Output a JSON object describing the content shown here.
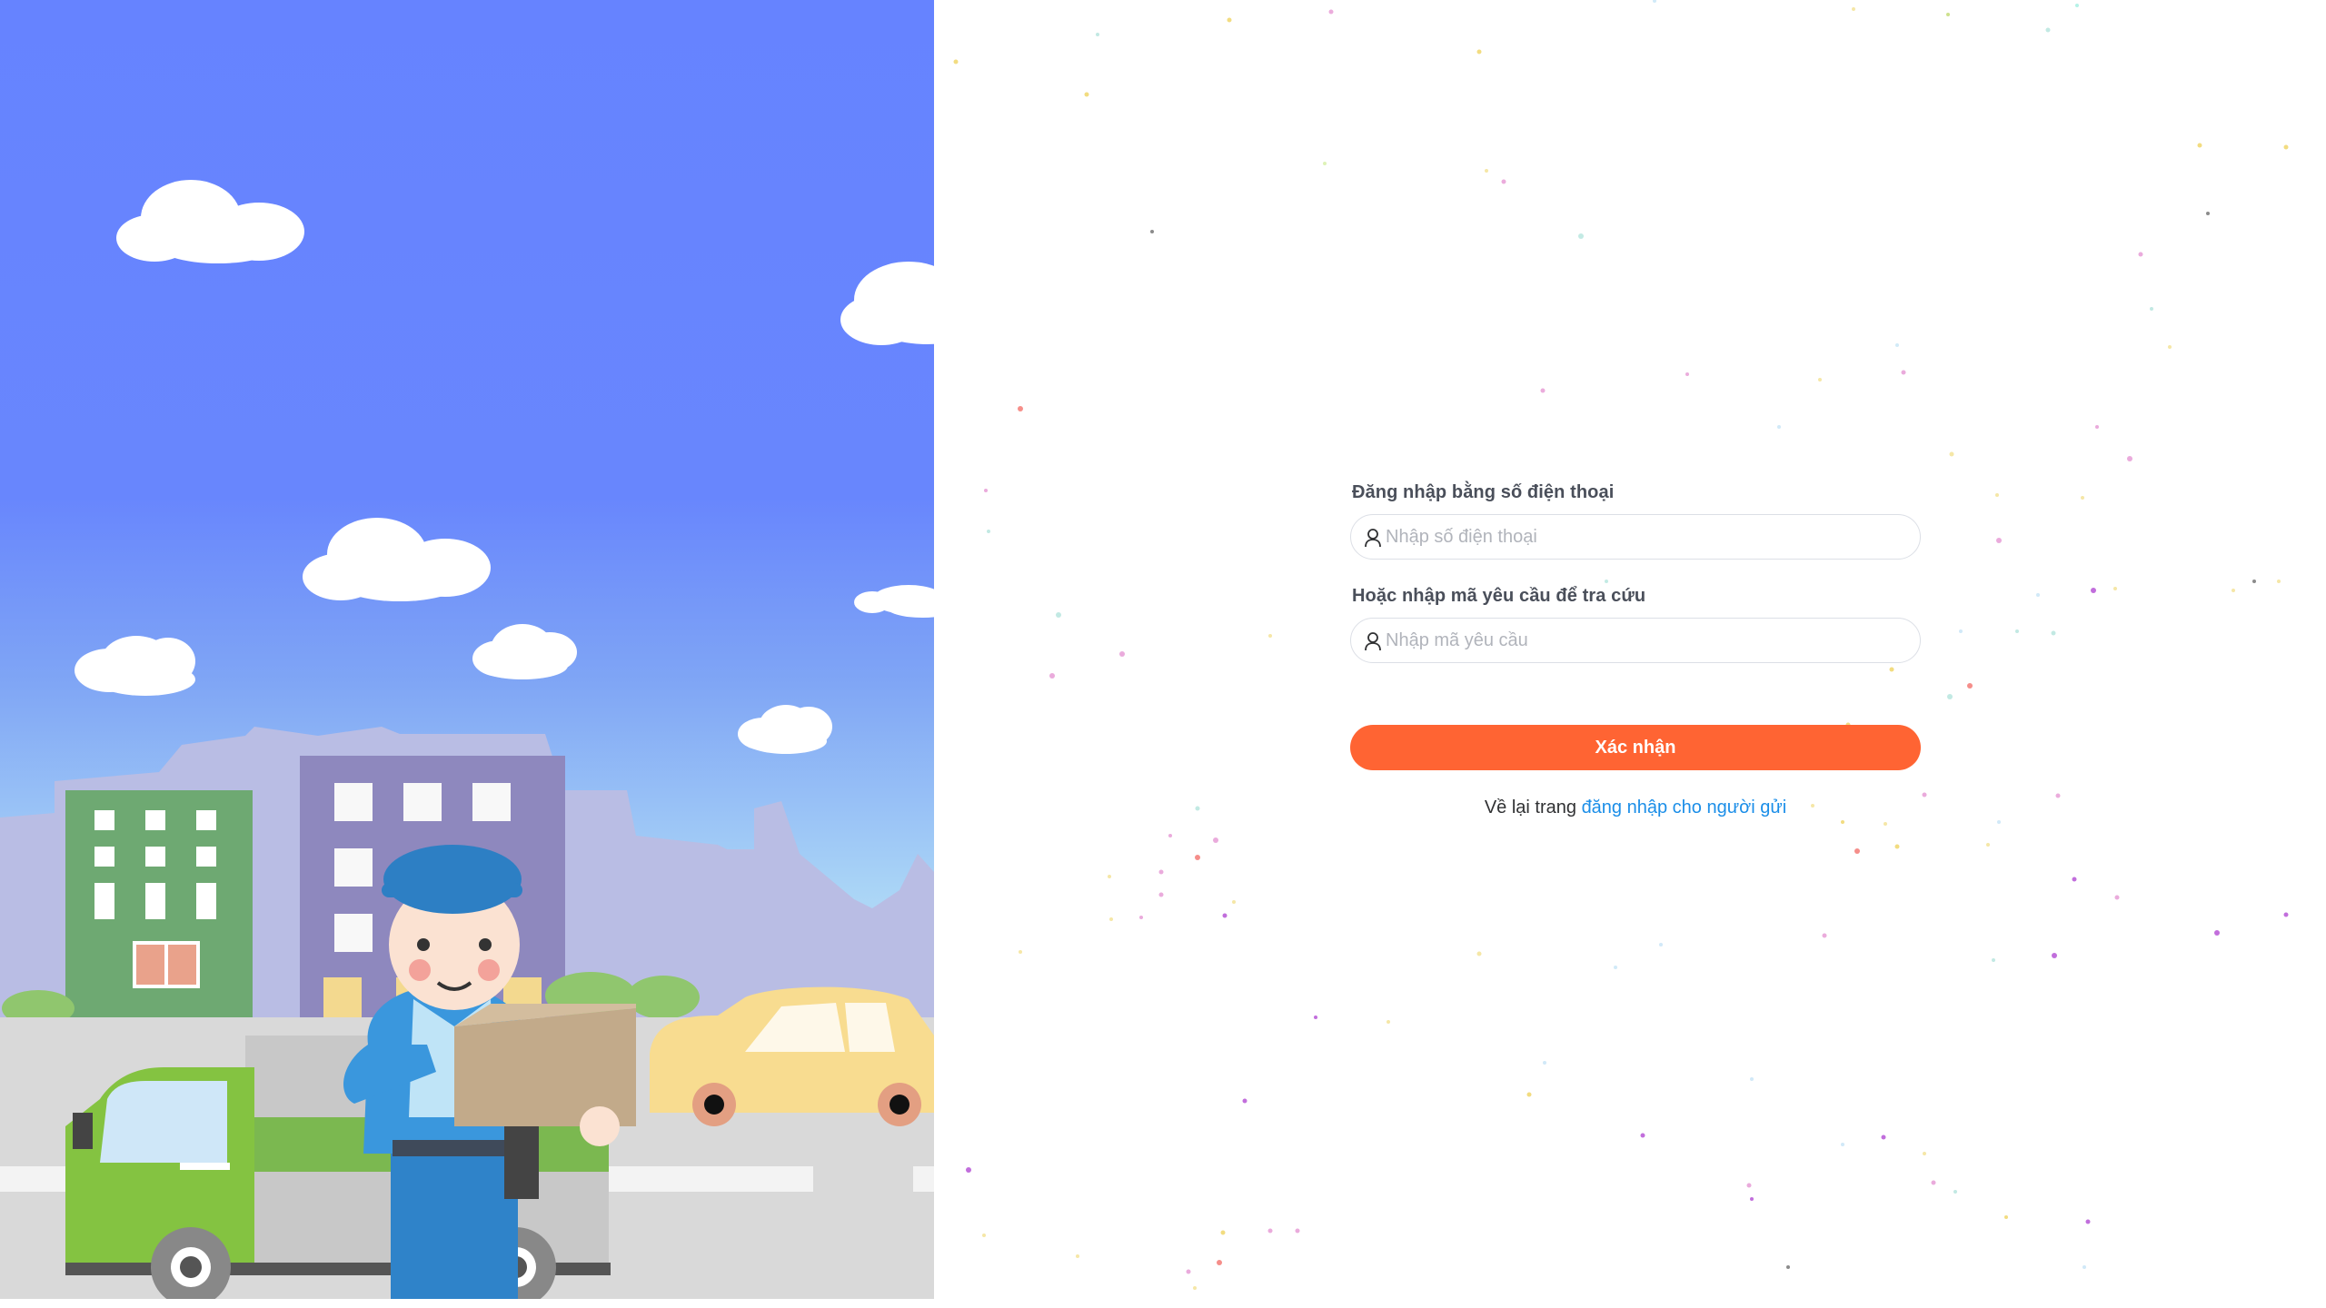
{
  "login_form": {
    "phone_label": "Đăng nhập bằng số điện thoại",
    "phone_placeholder": "Nhập số điện thoại",
    "request_label": "Hoặc nhập mã yêu cầu để tra cứu",
    "request_placeholder": "Nhập mã yêu cầu",
    "submit_label": "Xác nhận",
    "back_prefix": "Về lại trang",
    "back_link": "đăng nhập cho người gửi"
  },
  "icons": {
    "phone_field_icon": "user-icon",
    "request_field_icon": "user-icon"
  },
  "colors": {
    "accent_button": "#ff6433",
    "link": "#1b8ee8",
    "sky": "#6683ff"
  }
}
